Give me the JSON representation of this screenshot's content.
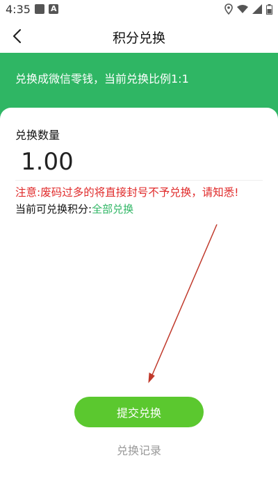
{
  "status_bar": {
    "time": "4:35",
    "left_icons": [
      "image-icon",
      "a-icon"
    ],
    "right_icons": [
      "location-icon",
      "wifi-icon",
      "signal-icon",
      "battery-icon"
    ]
  },
  "nav": {
    "title": "积分兑换",
    "back_icon": "chevron-left-icon"
  },
  "banner": {
    "text": "兑换成微信零钱，当前兑换比例1:1",
    "color": "#2fb664"
  },
  "form": {
    "amount_label": "兑换数量",
    "amount_value": "1.00",
    "warning": "注意:废码过多的将直接封号不予兑换，请知悉!",
    "points_prefix": "当前可兑换积分:",
    "exchange_all": "全部兑换",
    "warning_color": "#e02a2a",
    "link_color": "#2fb664"
  },
  "actions": {
    "submit_label": "提交兑换",
    "submit_color": "#5bc82f",
    "history_label": "兑换记录"
  }
}
